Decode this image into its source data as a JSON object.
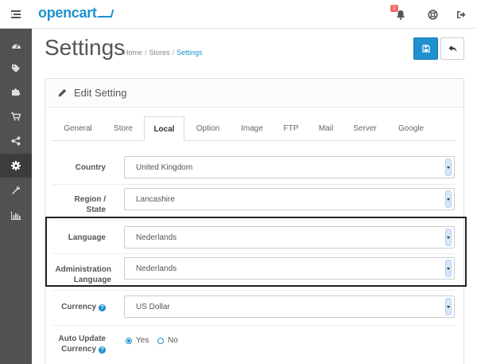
{
  "header": {
    "logo_text": "opencart",
    "notification_count": "1",
    "icons": [
      "menu-icon",
      "bell-icon",
      "life-ring-icon",
      "sign-out-icon"
    ]
  },
  "sidebar": {
    "items": [
      {
        "icon": "dashboard-icon",
        "active": false
      },
      {
        "icon": "tags-icon",
        "active": false
      },
      {
        "icon": "puzzle-icon",
        "active": false
      },
      {
        "icon": "cart-icon",
        "active": false
      },
      {
        "icon": "share-icon",
        "active": false
      },
      {
        "icon": "cog-icon",
        "active": true
      },
      {
        "icon": "wrench-icon",
        "active": false
      },
      {
        "icon": "bar-chart-icon",
        "active": false
      }
    ]
  },
  "page": {
    "title": "Settings",
    "breadcrumb": [
      "Home",
      "Stores",
      "Settings"
    ]
  },
  "panel": {
    "title": "Edit Setting"
  },
  "tabs": [
    {
      "label": "General",
      "active": false
    },
    {
      "label": "Store",
      "active": false
    },
    {
      "label": "Local",
      "active": true
    },
    {
      "label": "Option",
      "active": false
    },
    {
      "label": "Image",
      "active": false
    },
    {
      "label": "FTP",
      "active": false
    },
    {
      "label": "Mail",
      "active": false
    },
    {
      "label": "Server",
      "active": false
    },
    {
      "label": "Google",
      "active": false
    }
  ],
  "form": {
    "country": {
      "label": "Country",
      "value": "United Kingdom"
    },
    "region": {
      "label_line1": "Region /",
      "label_line2": "State",
      "value": "Lancashire"
    },
    "language": {
      "label": "Language",
      "value": "Nederlands"
    },
    "admin_language": {
      "label_line1": "Administration",
      "label_line2": "Language",
      "value": "Nederlands"
    },
    "currency": {
      "label": "Currency",
      "value": "US Dollar"
    },
    "auto_update_currency": {
      "label_line1": "Auto Update",
      "label_line2": "Currency",
      "yes": "Yes",
      "no": "No",
      "selected": "Yes"
    }
  },
  "colors": {
    "accent": "#1e91cf",
    "sidebar_bg": "#515151",
    "badge": "#f56b6b"
  }
}
